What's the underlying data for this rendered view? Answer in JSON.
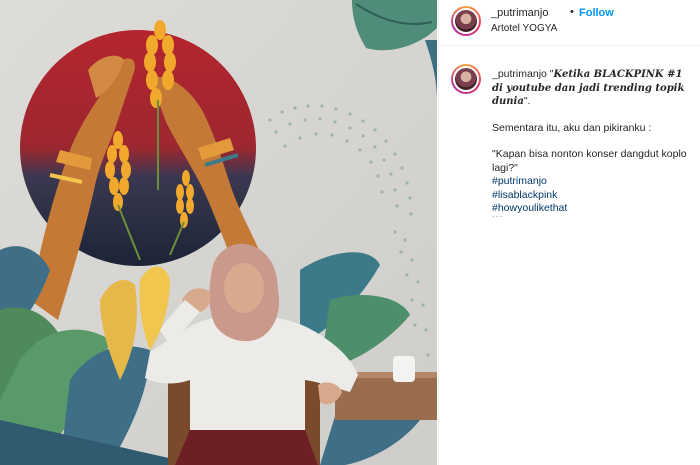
{
  "post": {
    "username": "_putrimanjo",
    "separator": "•",
    "follow_label": "Follow",
    "location": "Artotel YOGYA"
  },
  "caption": {
    "username": "_putrimanjo",
    "quote_open": "\"",
    "quote_text": "Ketika BLACKPINK #1 di youtube dan jadi trending topik dunia",
    "quote_close": "\".",
    "line2": "Sementara itu, aku dan pikiranku :",
    "line3": "\"Kapan bisa nonton konser dangdut koplo lagi?\"",
    "hashtags": [
      "#putrimanjo",
      "#lisablackpink",
      "#howyoulikethat"
    ],
    "more": "..."
  },
  "colors": {
    "follow_blue": "#0095f6",
    "hashtag_blue": "#00376b",
    "text": "#262626"
  },
  "icons": {
    "avatar_top": "profile-avatar",
    "avatar_caption": "profile-avatar"
  }
}
